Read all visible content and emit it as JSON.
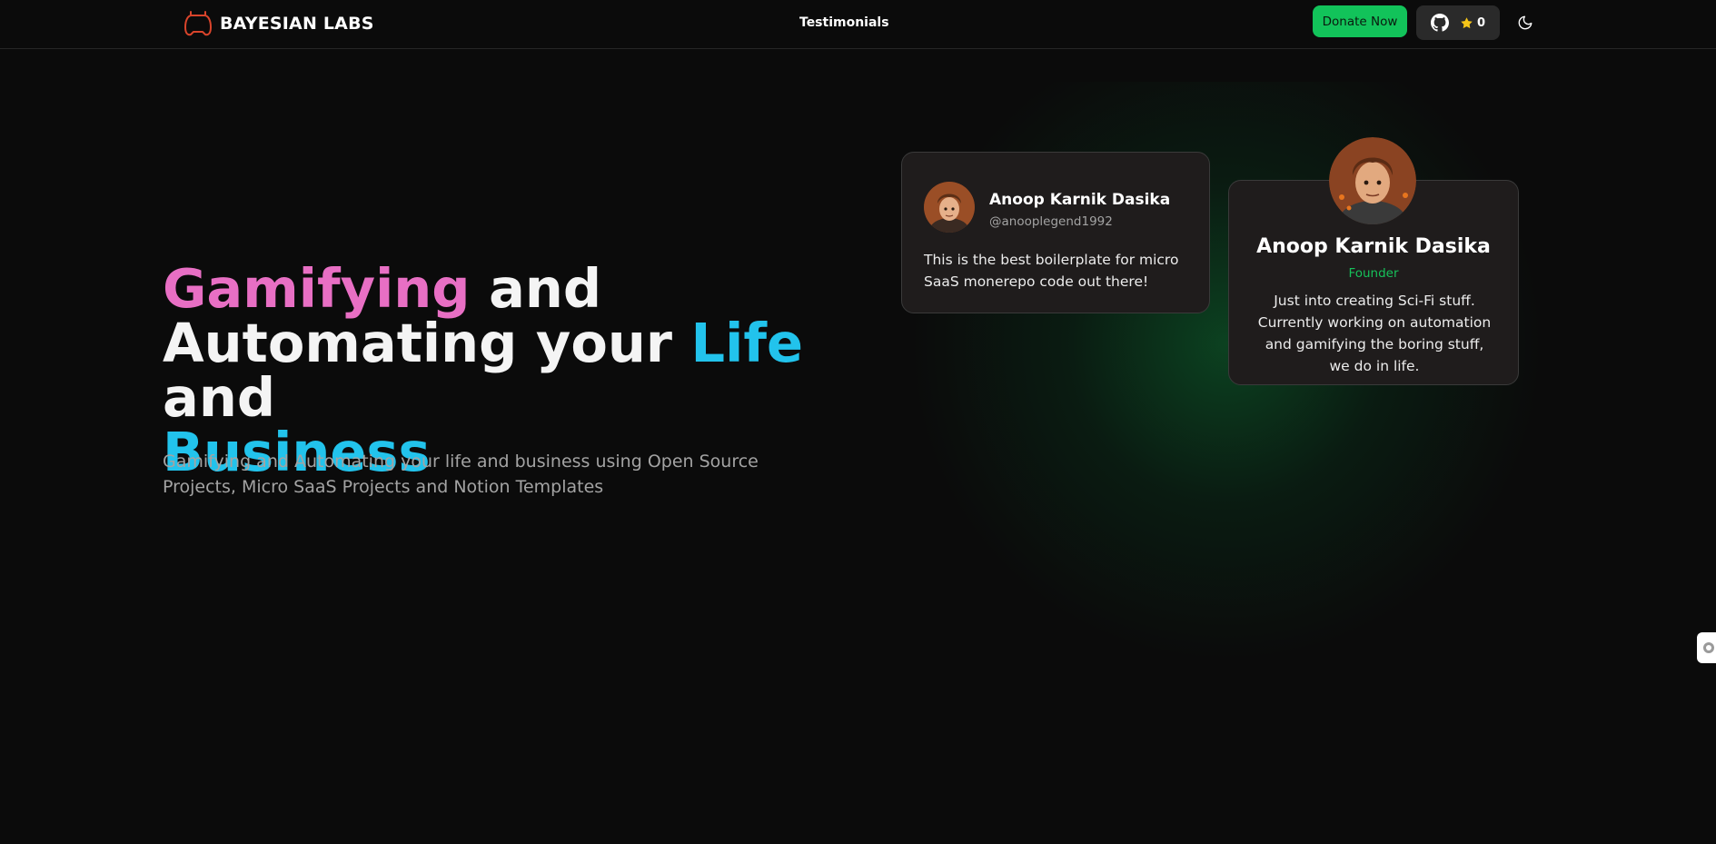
{
  "brand": {
    "name": "BAYESIAN LABS",
    "logo_icon": "gamepad-icon",
    "logo_color": "#d9442b"
  },
  "nav": {
    "center_link": "Testimonials",
    "donate_label": "Donate Now",
    "github": {
      "icon": "github-icon",
      "star_icon": "star-icon",
      "stars": "0"
    },
    "theme_toggle_icon": "moon-icon"
  },
  "hero": {
    "title": {
      "part1": "Gamifying",
      "part2": " and",
      "part3": "Automating your ",
      "part4": "Life",
      "part5": " and",
      "part6": "Business"
    },
    "subtitle": "Gamifying and Automating your life and business using Open Source Projects, Micro SaaS Projects and Notion Templates"
  },
  "testimonial": {
    "name": "Anoop Karnik Dasika",
    "handle": "@anooplegend1992",
    "quote": "This is the best boilerplate for micro SaaS monerepo code out there!"
  },
  "founder": {
    "name": "Anoop Karnik Dasika",
    "role": "Founder",
    "bio": "Just into creating Sci-Fi stuff. Currently working on automation and gamifying the boring stuff, we do in life."
  },
  "colors": {
    "accent_green": "#12c35a",
    "pink": "#e86fc4",
    "cyan": "#22c3ec",
    "background": "#0b0b0b"
  }
}
